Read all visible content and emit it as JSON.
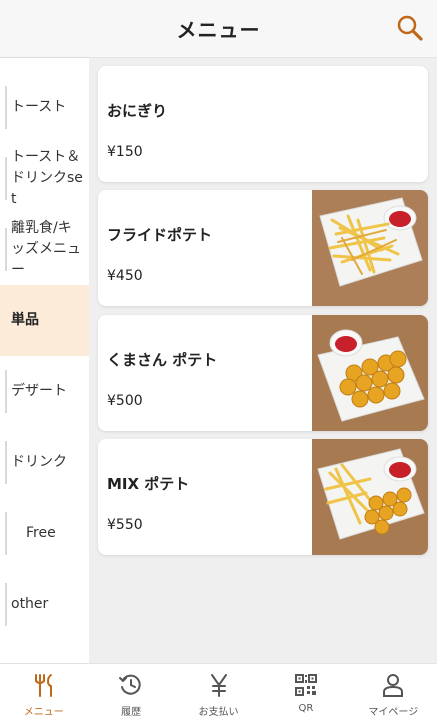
{
  "header": {
    "title": "メニュー",
    "search_icon": "search-icon"
  },
  "colors": {
    "accent": "#c0681a",
    "active_category_bg": "#fdebd9",
    "photo_bg": "#a87a52"
  },
  "sidebar": {
    "items": [
      {
        "label": "トースト",
        "active": false
      },
      {
        "label": "トースト＆ドリンクset",
        "active": false
      },
      {
        "label": "離乳食/キッズメニュー",
        "active": false
      },
      {
        "label": "単品",
        "active": true
      },
      {
        "label": "デザート",
        "active": false
      },
      {
        "label": "ドリンク",
        "active": false
      },
      {
        "label": "Free",
        "active": false
      },
      {
        "label": "other",
        "active": false
      }
    ]
  },
  "products": [
    {
      "name": "おにぎり",
      "price": "¥150",
      "image": "none"
    },
    {
      "name": "フライドポテト",
      "price": "¥450",
      "image": "fries-plate"
    },
    {
      "name": "くまさん ポテト",
      "price": "¥500",
      "image": "bear-potato-plate"
    },
    {
      "name": "MIX ポテト",
      "price": "¥550",
      "image": "mix-potato-plate"
    }
  ],
  "tabbar": {
    "items": [
      {
        "label": "メニュー",
        "icon": "fork-knife-icon",
        "active": true
      },
      {
        "label": "履歴",
        "icon": "history-icon",
        "active": false
      },
      {
        "label": "お支払い",
        "icon": "yen-icon",
        "active": false
      },
      {
        "label": "QR",
        "icon": "qr-code-icon",
        "active": false
      },
      {
        "label": "マイページ",
        "icon": "user-icon",
        "active": false
      }
    ]
  }
}
